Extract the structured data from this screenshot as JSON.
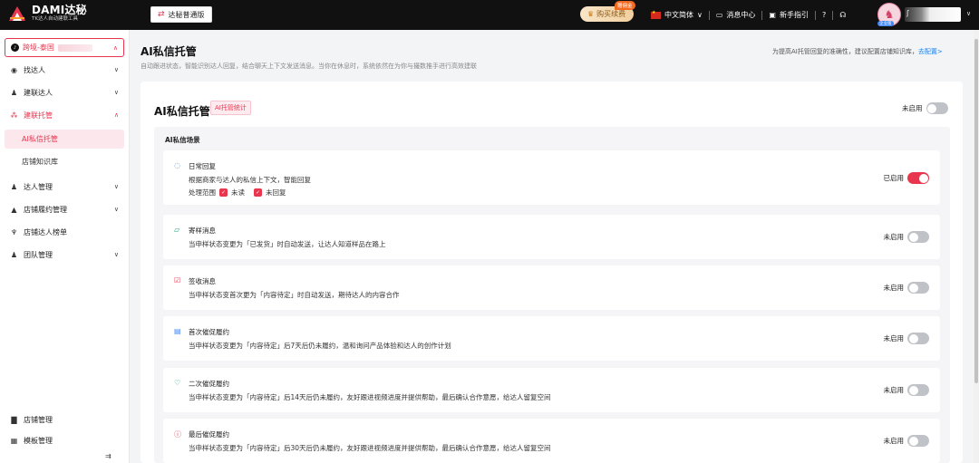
{
  "topbar": {
    "brand_title": "DAMI达秘",
    "brand_sub": "TK达人自动建联工具",
    "edition_label": "达秘普通版",
    "buy_label": "购买续费",
    "buy_badge": "赠佣金",
    "language": "中文简体",
    "messages": "消息中心",
    "guide": "新手指引",
    "help_glyph": "?",
    "avatar_badge": "企业版",
    "user_initial": "ʃ",
    "accent": "#e8364f"
  },
  "sidebar": {
    "region_label": "跨境-泰国",
    "items": [
      {
        "label": "找达人"
      },
      {
        "label": "建联达人"
      },
      {
        "label": "建联托管"
      },
      {
        "label": "达人管理"
      },
      {
        "label": "店铺履约管理"
      },
      {
        "label": "店铺达人榜单"
      },
      {
        "label": "团队管理"
      }
    ],
    "sub_items": [
      {
        "label": "AI私信托管"
      },
      {
        "label": "店铺知识库"
      }
    ],
    "bottom_items": [
      {
        "label": "店铺管理"
      },
      {
        "label": "模板管理"
      }
    ]
  },
  "main": {
    "page_title": "AI私信托管",
    "page_desc": "自动跟进状态，智能识别达人回复，结合聊天上下文发送消息。当你在休息时，系统依然在为你与撮数推手进行高效建联",
    "hint": "为提高AI托管回复的准确性，建议配置店铺知识库，",
    "hint_link": "去配置>",
    "card_title": "AI私信托管",
    "stat_tag": "AI托管统计",
    "card_status": "未启用",
    "scene_title": "AI私信场景",
    "scenes": [
      {
        "name": "日常回复",
        "desc": "根据商家与达人的私信上下文，智能回复",
        "range_label": "处理范围",
        "opt1": "未读",
        "opt2": "未回复",
        "status": "已启用",
        "on": true
      },
      {
        "name": "寄样消息",
        "desc": "当申样状态变更为「已发货」时自动发送，让达人知道样品在路上",
        "status": "未启用",
        "on": false
      },
      {
        "name": "签收消息",
        "desc": "当申样状态变首次更为「内容待定」时自动发送，期待达人的内容合作",
        "status": "未启用",
        "on": false
      },
      {
        "name": "首次催促履约",
        "desc": "当申样状态变更为「内容待定」后7天后仍未履约，温和询问产品体验和达人的创作计划",
        "status": "未启用",
        "on": false
      },
      {
        "name": "二次催促履约",
        "desc": "当申样状态变更为「内容待定」后14天后仍未履约，友好跟进视频进度并提供帮助，最后确认合作意愿，给达人留复空间",
        "status": "未启用",
        "on": false
      },
      {
        "name": "最后催促履约",
        "desc": "当申样状态变更为「内容待定」后30天后仍未履约，友好跟进视频进度并提供帮助，最后确认合作意愿，给达人留复空间",
        "status": "未启用",
        "on": false
      }
    ]
  }
}
